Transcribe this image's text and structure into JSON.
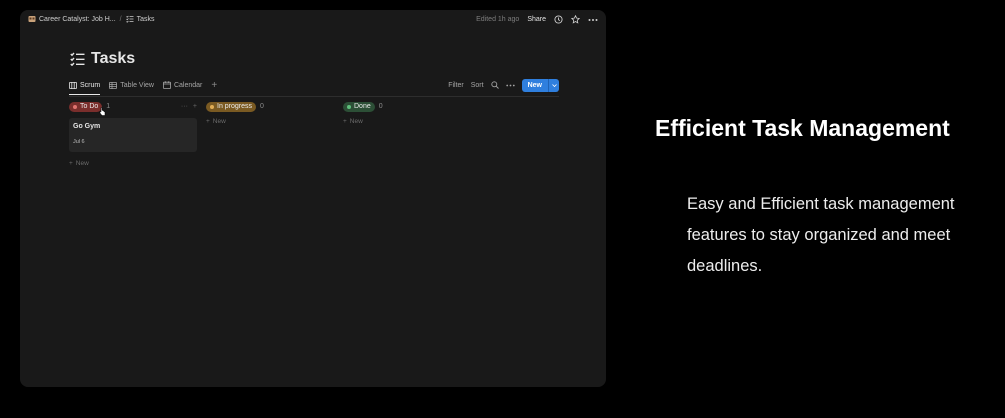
{
  "window": {
    "breadcrumbs": [
      "Career Catalyst: Job H...",
      "Tasks"
    ],
    "edited": "Edited 1h ago",
    "share": "Share"
  },
  "page": {
    "title": "Tasks"
  },
  "views": {
    "tabs": [
      "Scrum",
      "Table View",
      "Calendar"
    ],
    "active": "Scrum",
    "filter": "Filter",
    "sort": "Sort",
    "new_button": "New"
  },
  "board": {
    "columns": [
      {
        "name": "To Do",
        "count": "1",
        "color": "#b5403c",
        "dot": "#e07470",
        "cards": [
          {
            "title": "Go Gym",
            "date": "Jul 6"
          }
        ],
        "new_label": "New"
      },
      {
        "name": "In progress",
        "count": "0",
        "color": "#8a6426",
        "dot": "#e0ad55",
        "cards": [],
        "new_label": "New"
      },
      {
        "name": "Done",
        "count": "0",
        "color": "#2e5a3c",
        "dot": "#5fbf7c",
        "cards": [],
        "new_label": "New"
      }
    ]
  },
  "promo": {
    "title": "Efficient Task Management",
    "body": "Easy and Efficient task management features to stay organized and meet deadlines."
  },
  "colors": {
    "accent": "#2f7fde",
    "app_bg": "#191919",
    "page_bg": "#000000"
  }
}
